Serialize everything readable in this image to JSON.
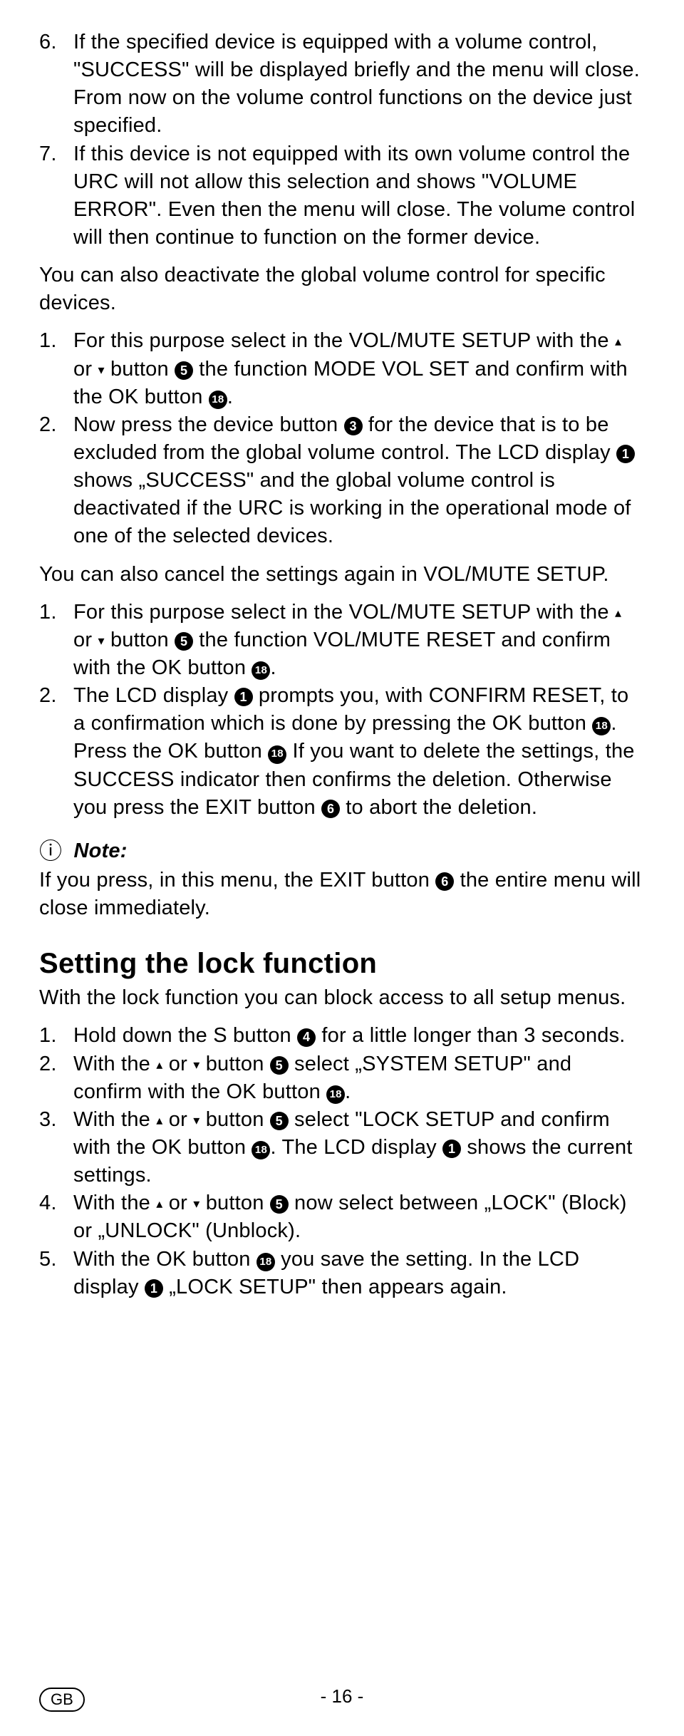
{
  "list1": {
    "i6": {
      "num": "6.",
      "text_a": "If the specified device is equipped with a volume control, \"SUCCESS\" will be displayed briefly and the menu will close. From now on the volume control functions on the device just specified."
    },
    "i7": {
      "num": "7.",
      "text_a": "If this device is not equipped with its own volume control the URC will not allow this selection and shows \"VOLUME ERROR\". Even then the menu will close. The volume control will then continue to function on the former device."
    }
  },
  "para1": "You can also deactivate the global volume control for specific devices.",
  "list2": {
    "i1": {
      "num": "1.",
      "a": "For this purpose select in the VOL/MUTE SETUP with the ",
      "b": " or ",
      "c": " button ",
      "d": " the function MODE VOL SET and confirm with the OK button ",
      "e": "."
    },
    "i2": {
      "num": "2.",
      "a": "Now press the device button ",
      "b": " for the device that is to be excluded from the global volume control. The LCD display ",
      "c": " shows „SUCCESS\" and the global volume control is deactivated if the URC is working in the operational mode of one of the selected devices."
    }
  },
  "para2": "You can also cancel the settings again in VOL/MUTE SETUP.",
  "list3": {
    "i1": {
      "num": "1.",
      "a": "For this purpose select in the VOL/MUTE SETUP with the ",
      "b": " or ",
      "c": " button ",
      "d": " the function VOL/MUTE RESET and confirm with the OK button ",
      "e": "."
    },
    "i2": {
      "num": "2.",
      "a": "The LCD display ",
      "b": " prompts you, with CONFIRM RESET, to a confirmation which is done by pressing the OK button ",
      "c": ". Press the OK button ",
      "d": " If you want to delete the settings, the SUCCESS indicator then confirms the deletion. Otherwise you press the EXIT button ",
      "e": " to abort the deletion."
    }
  },
  "note": {
    "label": "Note:",
    "a": "If you press, in this menu, the EXIT button ",
    "b": " the entire menu will close immediately."
  },
  "h2": "Setting the lock function",
  "para3": "With the lock function you can block access to all setup menus.",
  "list4": {
    "i1": {
      "num": "1.",
      "a": "Hold down the S button ",
      "b": " for a little longer than 3 seconds."
    },
    "i2": {
      "num": "2.",
      "a": "With the ",
      "b": " or ",
      "c": " button ",
      "d": " select „SYSTEM SETUP\" and confirm with the OK button ",
      "e": "."
    },
    "i3": {
      "num": "3.",
      "a": "With the ",
      "b": " or ",
      "c": " button ",
      "d": " select \"LOCK SETUP and confirm with the OK button ",
      "e": ". The LCD display ",
      "f": " shows the current settings."
    },
    "i4": {
      "num": "4.",
      "a": "With the ",
      "b": " or ",
      "c": " button ",
      "d": " now select between „LOCK\" (Block) or „UNLOCK\" (Unblock)."
    },
    "i5": {
      "num": "5.",
      "a": "With the OK button ",
      "b": " you save the setting. In the LCD display ",
      "c": " „LOCK SETUP\" then appears again."
    }
  },
  "icons": {
    "n1": "1",
    "n3": "3",
    "n4": "4",
    "n5": "5",
    "n6": "6",
    "n18": "18",
    "up": "▴",
    "down": "▾",
    "info": "ⓘ"
  },
  "footer": {
    "gb": "GB",
    "page": "- 16 -"
  }
}
